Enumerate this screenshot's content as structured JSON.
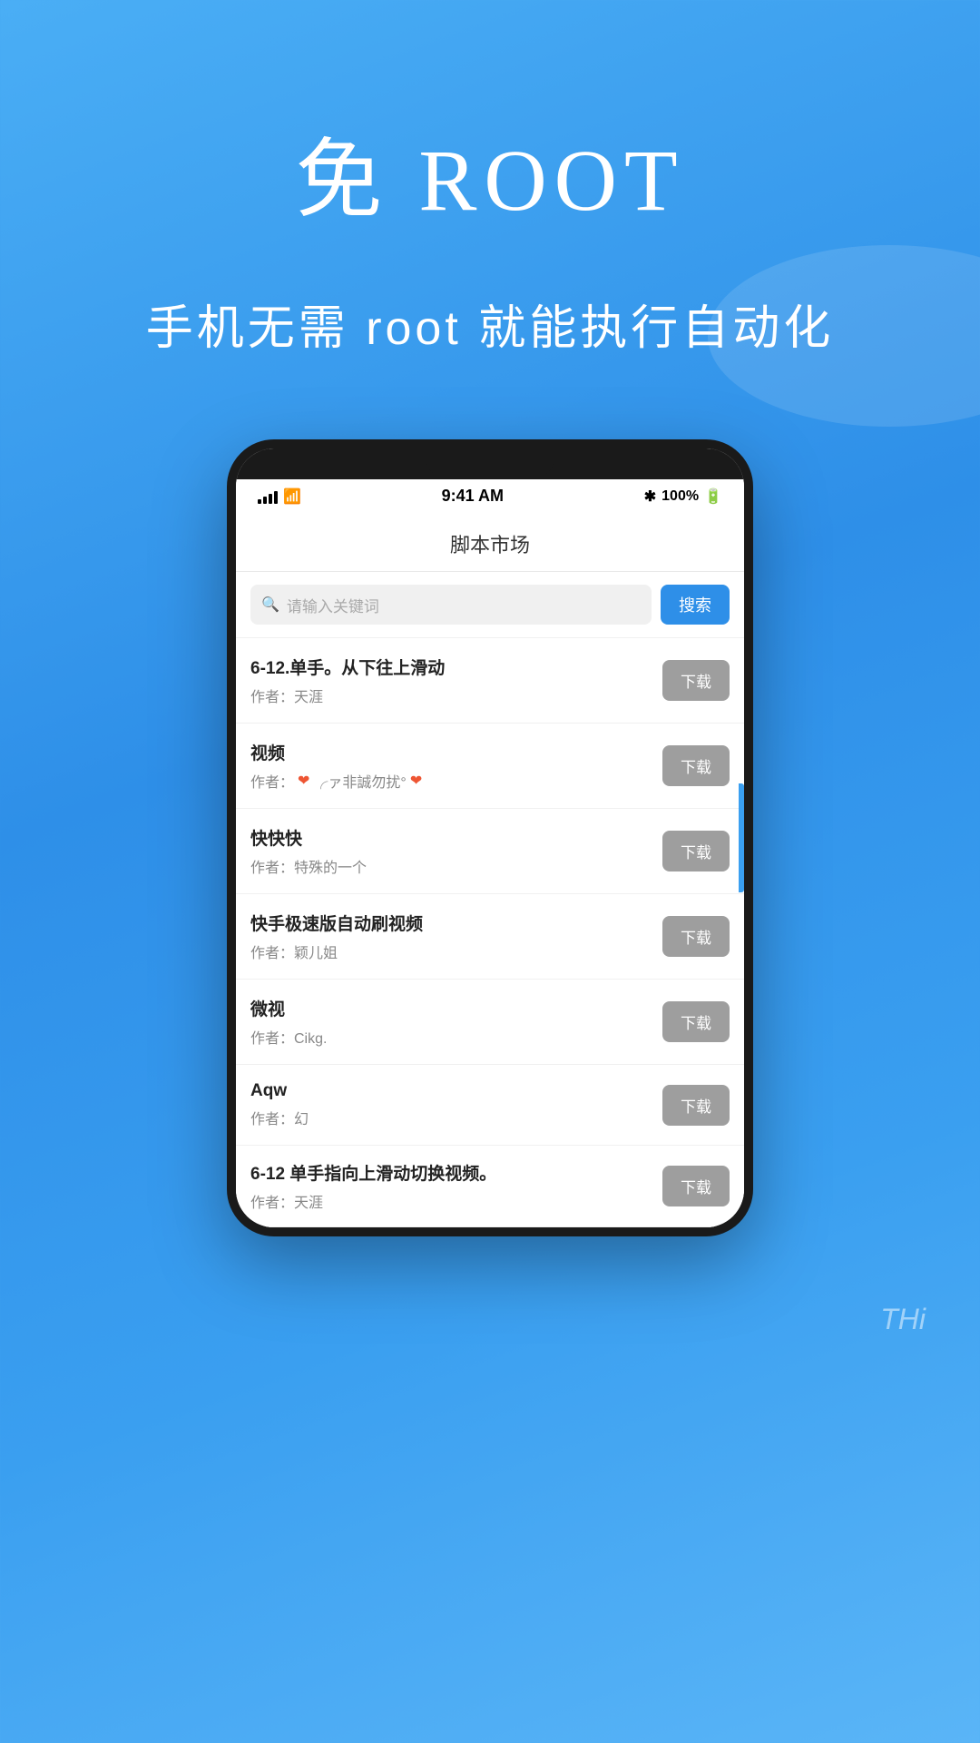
{
  "hero": {
    "title": "免 ROOT",
    "subtitle": "手机无需 root 就能执行自动化"
  },
  "phone": {
    "status_bar": {
      "time": "9:41 AM",
      "battery": "100%",
      "bluetooth": "✱"
    },
    "app_title": "脚本市场",
    "search": {
      "placeholder": "请输入关键词",
      "button_label": "搜索"
    },
    "items": [
      {
        "title": "6-12.单手。从下往上滑动",
        "author": "作者：天涯",
        "download_label": "下载"
      },
      {
        "title": "视频",
        "author_prefix": "作者：",
        "author_name": "❤ ╭ァ非誠勿扰°❤",
        "download_label": "下载"
      },
      {
        "title": "快快快",
        "author": "作者：特殊的一个",
        "download_label": "下载"
      },
      {
        "title": "快手极速版自动刷视频",
        "author": "作者：颖儿姐",
        "download_label": "下载"
      },
      {
        "title": "微视",
        "author": "作者：Cikg.",
        "download_label": "下载"
      },
      {
        "title": "Aqw",
        "author": "作者：幻",
        "download_label": "下载"
      },
      {
        "title": "6-12  单手指向上滑动切换视频。",
        "author_partial": "作者：天涯",
        "download_label": "下载"
      }
    ]
  },
  "bottom_watermark": "THi"
}
